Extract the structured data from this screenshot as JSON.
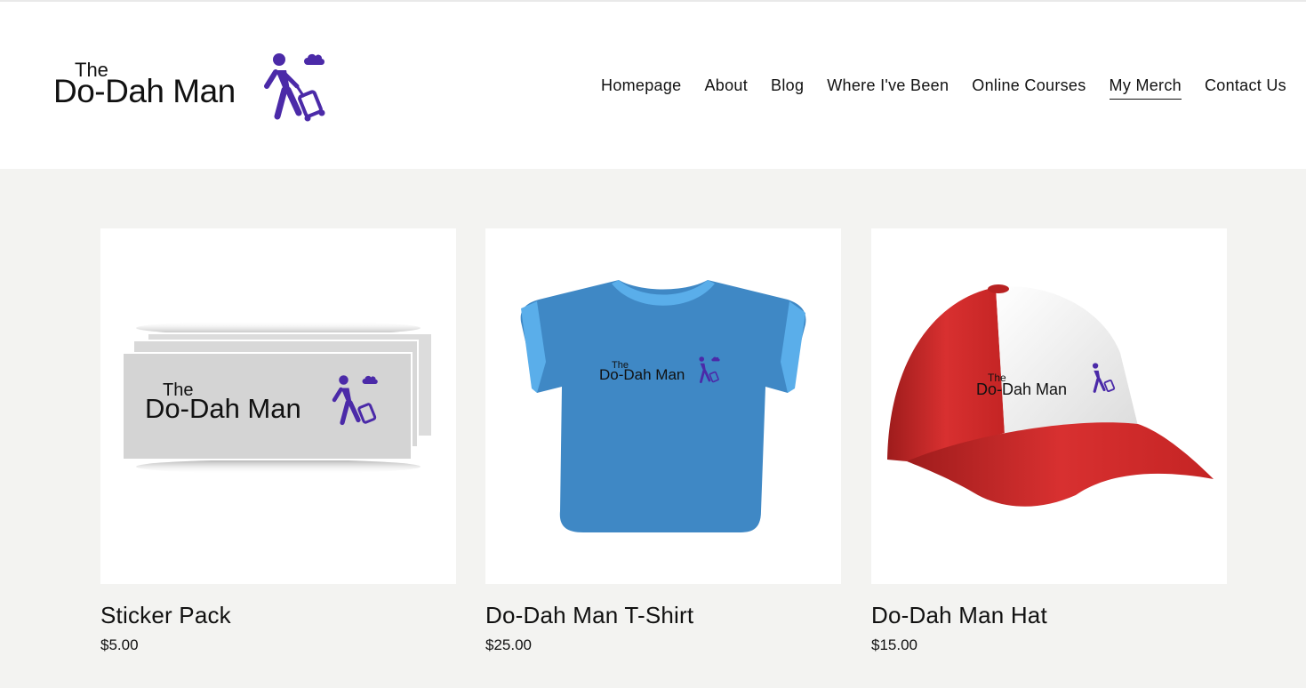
{
  "brand": {
    "logo_the": "The",
    "logo_main": "Do-Dah Man",
    "accent_color": "#4b2aa8"
  },
  "nav": {
    "items": [
      {
        "label": "Homepage"
      },
      {
        "label": "About"
      },
      {
        "label": "Blog"
      },
      {
        "label": "Where I've Been"
      },
      {
        "label": "Online Courses"
      },
      {
        "label": "My Merch",
        "active": true
      },
      {
        "label": "Contact Us"
      }
    ]
  },
  "products": [
    {
      "title": "Sticker Pack",
      "price": "$5.00",
      "icon": "sticker-pack-image"
    },
    {
      "title": "Do-Dah Man T-Shirt",
      "price": "$25.00",
      "icon": "tshirt-image",
      "color": "#3f88c5"
    },
    {
      "title": "Do-Dah Man Hat",
      "price": "$15.00",
      "icon": "cap-image",
      "color": "#d42a2a"
    }
  ]
}
